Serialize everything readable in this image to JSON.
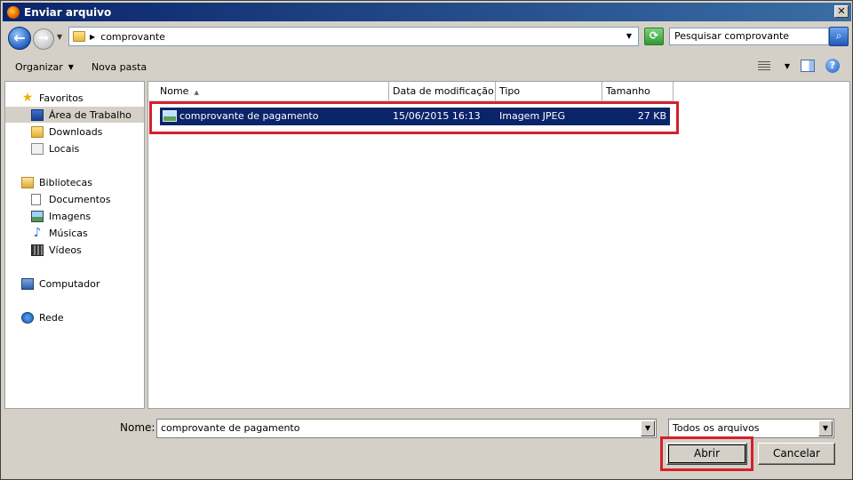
{
  "window": {
    "title": "Enviar arquivo"
  },
  "address": {
    "path": "comprovante",
    "search_placeholder": "Pesquisar comprovante"
  },
  "toolbar": {
    "organize_label": "Organizar",
    "new_folder_label": "Nova pasta"
  },
  "sidebar": {
    "favorites_label": "Favoritos",
    "favorites": [
      {
        "label": "Área de Trabalho",
        "icon": "desktop-icon",
        "selected": true
      },
      {
        "label": "Downloads",
        "icon": "downloads-folder-icon"
      },
      {
        "label": "Locais",
        "icon": "recent-places-icon"
      }
    ],
    "libraries_label": "Bibliotecas",
    "libraries": [
      {
        "label": "Documentos",
        "icon": "documents-icon"
      },
      {
        "label": "Imagens",
        "icon": "pictures-icon"
      },
      {
        "label": "Músicas",
        "icon": "music-icon"
      },
      {
        "label": "Vídeos",
        "icon": "videos-icon"
      }
    ],
    "computer_label": "Computador",
    "network_label": "Rede"
  },
  "columns": {
    "name": "Nome",
    "modified": "Data de modificação",
    "type": "Tipo",
    "size": "Tamanho"
  },
  "files": [
    {
      "name": "comprovante de pagamento",
      "modified": "15/06/2015 16:13",
      "type": "Imagem JPEG",
      "size": "27 KB",
      "selected": true
    }
  ],
  "footer": {
    "filename_label": "Nome:",
    "filename_value": "comprovante de pagamento",
    "filter_value": "Todos os arquivos",
    "open_label": "Abrir",
    "cancel_label": "Cancelar"
  },
  "colors": {
    "selection": "#0a246a",
    "highlight": "#d3212d",
    "titlebar": "#0a246a"
  }
}
